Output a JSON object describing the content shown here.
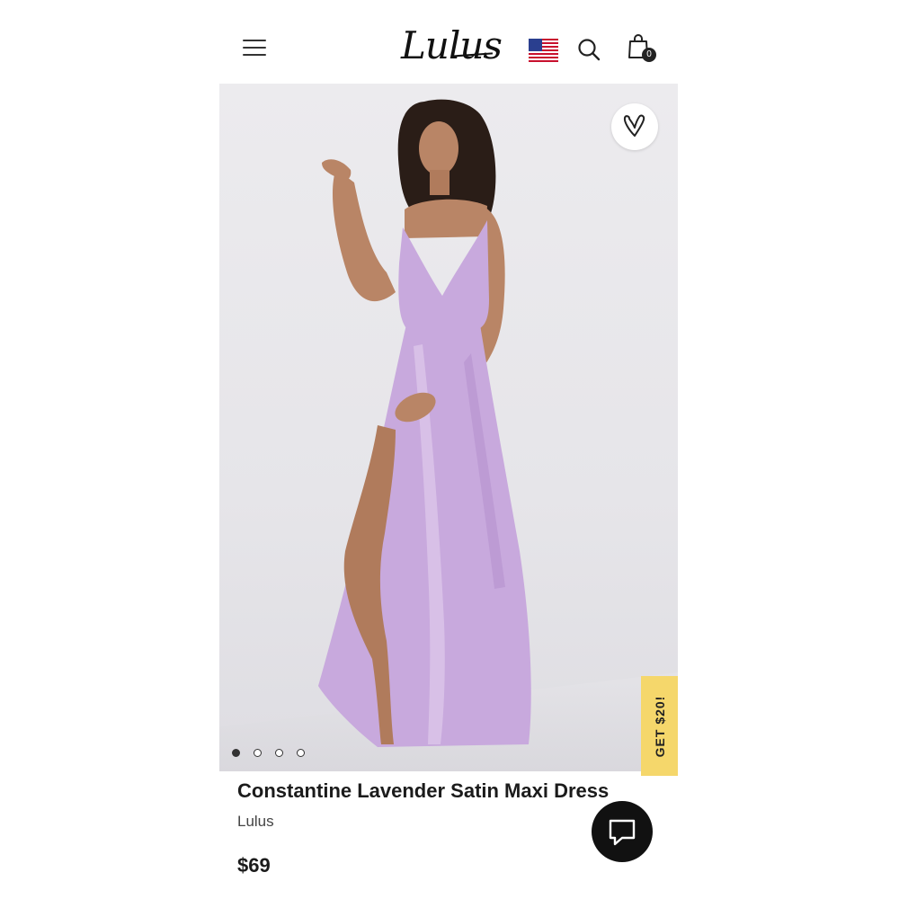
{
  "header": {
    "logo_text": "Lulus",
    "cart_count": "0",
    "icons": [
      "menu-icon",
      "us-flag-icon",
      "search-icon",
      "shopping-bag-icon"
    ]
  },
  "hero": {
    "carousel_count": 4,
    "active_slide": 1,
    "favorite_icon": "heart-icon"
  },
  "promo": {
    "label": "GET $20!"
  },
  "product": {
    "title": "Constantine Lavender Satin Maxi Dress",
    "brand": "Lulus",
    "price": "$69"
  },
  "chat": {
    "icon": "chat-bubble-icon"
  },
  "colors": {
    "dress": "#c8a9dd",
    "promo_bg": "#f5d76b",
    "text": "#1b1b1b",
    "chat_bg": "#111111"
  }
}
